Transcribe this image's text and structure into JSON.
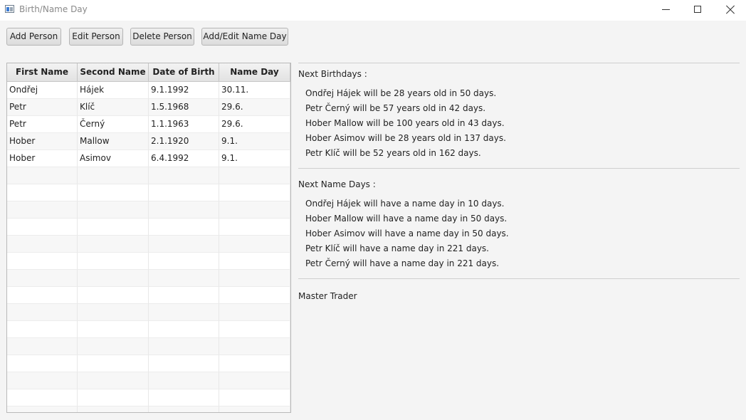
{
  "window": {
    "title": "Birth/Name Day",
    "icon": "app-window-icon",
    "controls": [
      "minimize-icon",
      "maximize-icon",
      "close-icon"
    ]
  },
  "toolbar": {
    "add_person": "Add Person",
    "edit_person": "Edit Person",
    "delete_person": "Delete Person",
    "add_edit_name_day": "Add/Edit Name Day"
  },
  "table": {
    "columns": [
      "First Name",
      "Second Name",
      "Date of Birth",
      "Name Day"
    ],
    "rows": [
      [
        "Ondřej",
        "Hájek",
        "9.1.1992",
        "30.11."
      ],
      [
        "Petr",
        "Klíč",
        "1.5.1968",
        "29.6."
      ],
      [
        "Petr",
        "Černý",
        "1.1.1963",
        "29.6."
      ],
      [
        "Hober",
        "Mallow",
        "2.1.1920",
        "9.1."
      ],
      [
        "Hober",
        "Asimov",
        "6.4.1992",
        "9.1."
      ]
    ]
  },
  "birthdays": {
    "title": "Next Birthdays :",
    "items": [
      "Ondřej Hájek will be 28 years old in 50 days.",
      "Petr Černý will be 57 years old in 42 days.",
      "Hober Mallow will be 100 years old in 43 days.",
      "Hober Asimov will be 28 years old in 137 days.",
      "Petr Klíč will be 52 years old in 162 days."
    ]
  },
  "namedays": {
    "title": "Next Name Days :",
    "items": [
      "Ondřej Hájek will have a name day in 10 days.",
      "Hober Mallow will have a name day in 50 days.",
      "Hober Asimov will have a name day in 50 days.",
      "Petr Klíč will have a name day in 221 days.",
      "Petr Černý will have a name day in 221 days."
    ]
  },
  "footer_text": "Master Trader"
}
